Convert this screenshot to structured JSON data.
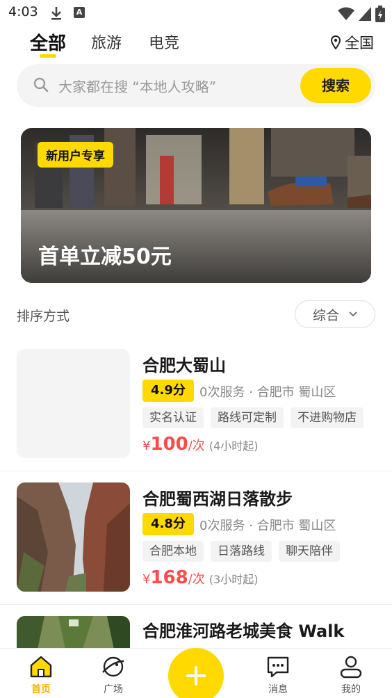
{
  "status_bar": {
    "time": "4:03"
  },
  "tabs": [
    {
      "label": "全部",
      "active": true
    },
    {
      "label": "旅游",
      "active": false
    },
    {
      "label": "电竞",
      "active": false
    }
  ],
  "region": {
    "label": "全国",
    "icon": "location-pin-icon"
  },
  "search": {
    "placeholder": "大家都在搜 “本地人攻略”",
    "button_label": "搜索"
  },
  "banner": {
    "badge": "新用户专享",
    "headline": "首单立减50元"
  },
  "sort": {
    "label": "排序方式",
    "selected": "综合"
  },
  "items": [
    {
      "title": "合肥大蜀山",
      "rating": "4.9分",
      "meta": "0次服务 · 合肥市 蜀山区",
      "tags": [
        "实名认证",
        "路线可定制",
        "不进购物店"
      ],
      "currency": "¥",
      "price": "100",
      "unit": "/次",
      "duration": "(4小时起)"
    },
    {
      "title": "合肥蜀西湖日落散步",
      "rating": "4.8分",
      "meta": "0次服务 · 合肥市 蜀山区",
      "tags": [
        "合肥本地",
        "日落路线",
        "聊天陪伴"
      ],
      "currency": "¥",
      "price": "168",
      "unit": "/次",
      "duration": "(3小时起)"
    },
    {
      "title": "合肥淮河路老城美食 Walk"
    }
  ],
  "bottom_nav": [
    {
      "label": "首页",
      "icon": "home-icon",
      "active": true
    },
    {
      "label": "广场",
      "icon": "planet-icon",
      "active": false
    },
    {
      "label": "",
      "icon": "plus-icon",
      "active": false
    },
    {
      "label": "消息",
      "icon": "message-icon",
      "active": false
    },
    {
      "label": "我的",
      "icon": "profile-icon",
      "active": false
    }
  ],
  "colors": {
    "accent": "#ffd900",
    "price": "#ff4a4a",
    "active_label": "#f2b600"
  }
}
